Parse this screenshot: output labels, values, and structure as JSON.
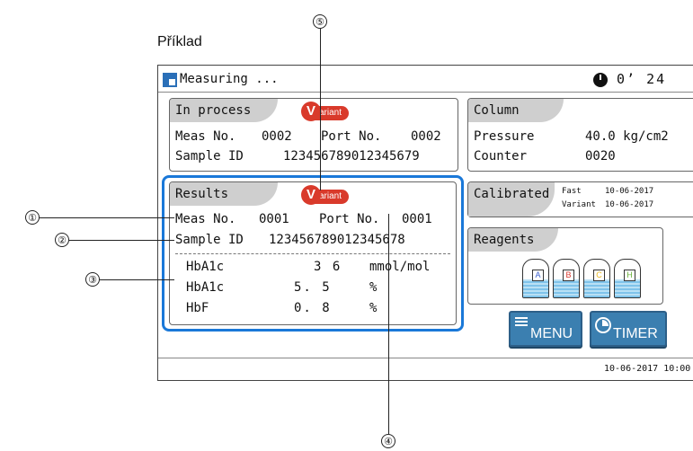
{
  "caption": "Příklad",
  "header": {
    "title": "Measuring ...",
    "timer": "0’ 24"
  },
  "in_process": {
    "tab": "In process",
    "meas_label": "Meas No.",
    "meas_value": "0002",
    "port_label": "Port No.",
    "port_value": "0002",
    "sample_label": "Sample ID",
    "sample_value": "123456789012345679",
    "badge_v": "V",
    "badge_text": "ariant"
  },
  "results": {
    "tab": "Results",
    "meas_label": "Meas No.",
    "meas_value": "0001",
    "port_label": "Port No.",
    "port_value": "0001",
    "sample_label": "Sample ID",
    "sample_value": "123456789012345678",
    "badge_v": "V",
    "badge_text": "ariant",
    "rows": [
      {
        "name": "HbA1c",
        "value": "3 6",
        "unit": "mmol/mol"
      },
      {
        "name": "HbA1c",
        "value": "5. 5",
        "unit": "%"
      },
      {
        "name": "HbF",
        "value": "0. 8",
        "unit": "%"
      }
    ]
  },
  "column": {
    "tab": "Column",
    "pressure_label": "Pressure",
    "pressure_value": "40.0 kg/cm2",
    "counter_label": "Counter",
    "counter_value": "0020"
  },
  "calibrated": {
    "tab": "Calibrated",
    "fast_label": "Fast",
    "fast_date": "10-06-2017",
    "variant_label": "Variant",
    "variant_date": "10-06-2017"
  },
  "reagents": {
    "tab": "Reagents",
    "bottles": [
      {
        "letter": "A",
        "color": "#3a5fcf"
      },
      {
        "letter": "B",
        "color": "#d8342a"
      },
      {
        "letter": "C",
        "color": "#e9b820"
      },
      {
        "letter": "H",
        "color": "#6ab23a"
      }
    ]
  },
  "buttons": {
    "menu": "MENU",
    "timer": "TIMER"
  },
  "footer": {
    "datetime": "10-06-2017 10:00"
  },
  "callouts": [
    "①",
    "②",
    "③",
    "④",
    "⑤"
  ],
  "colors": {
    "highlight": "#1a78d8",
    "tab": "#cfcfcf",
    "button": "#3b7fb0",
    "badge": "#d93a2b"
  }
}
